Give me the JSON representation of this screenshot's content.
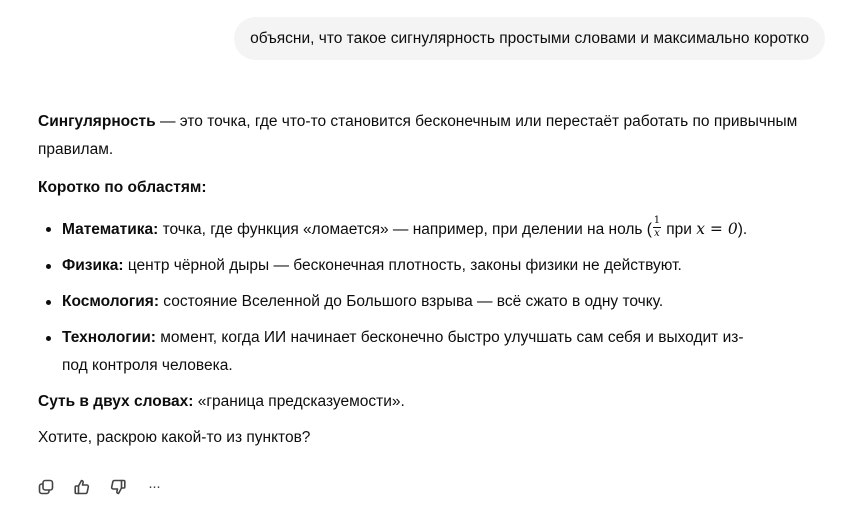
{
  "user_message": "объясни, что такое сигнулярность простыми словами и максимально коротко",
  "answer": {
    "intro_term": "Сингулярность",
    "intro_text": " — это точка, где что-то становится бесконечным или перестаёт работать по привычным правилам.",
    "areas_heading": "Коротко по областям:",
    "items": [
      {
        "term": "Математика:",
        "text": " точка, где функция «ломается» — например, при делении на ноль (",
        "frac_num": "1",
        "frac_den": "x",
        "text_after": " при ",
        "math_expr": "x = 0",
        "text_end": ")."
      },
      {
        "term": "Физика:",
        "text": " центр чёрной дыры — бесконечная плотность, законы физики не действуют."
      },
      {
        "term": "Космология:",
        "text": " состояние Вселенной до Большого взрыва — всё сжато в одну точку."
      },
      {
        "term": "Технологии:",
        "text": " момент, когда ИИ начинает бесконечно быстро улучшать сам себя и выходит из-под контроля человека."
      }
    ],
    "summary_term": "Суть в двух словах:",
    "summary_text": " «граница предсказуемости».",
    "question": "Хотите, раскрою какой-то из пунктов?"
  },
  "actions": {
    "copy_icon": "copy-icon",
    "like_icon": "thumbs-up-icon",
    "dislike_icon": "thumbs-down-icon",
    "more_label": "···"
  }
}
